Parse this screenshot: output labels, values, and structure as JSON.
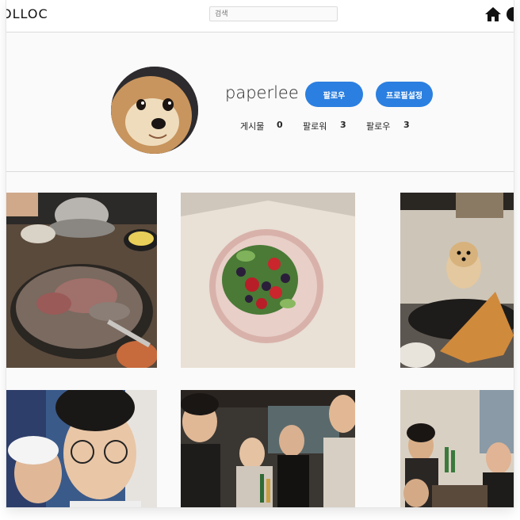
{
  "nav": {
    "logo": "OLLOC",
    "search_placeholder": "검색",
    "home_icon": "home-icon",
    "profile_icon": "user-icon"
  },
  "profile": {
    "username": "paperlee",
    "follow_button": "팔로우",
    "settings_button": "프로필설정",
    "stats": [
      {
        "label": "게시물",
        "value": "0"
      },
      {
        "label": "팔로워",
        "value": "3"
      },
      {
        "label": "팔로우",
        "value": "3"
      }
    ]
  },
  "colors": {
    "accent": "#2b7fe0",
    "background": "#fafafa",
    "border": "#dbdbdb"
  },
  "posts": [
    {
      "subject": "korean bbq grill"
    },
    {
      "subject": "salad bowl"
    },
    {
      "subject": "pomeranian dog with chip"
    },
    {
      "subject": "selfie two people"
    },
    {
      "subject": "group at cafe"
    },
    {
      "subject": "group dinner"
    }
  ]
}
